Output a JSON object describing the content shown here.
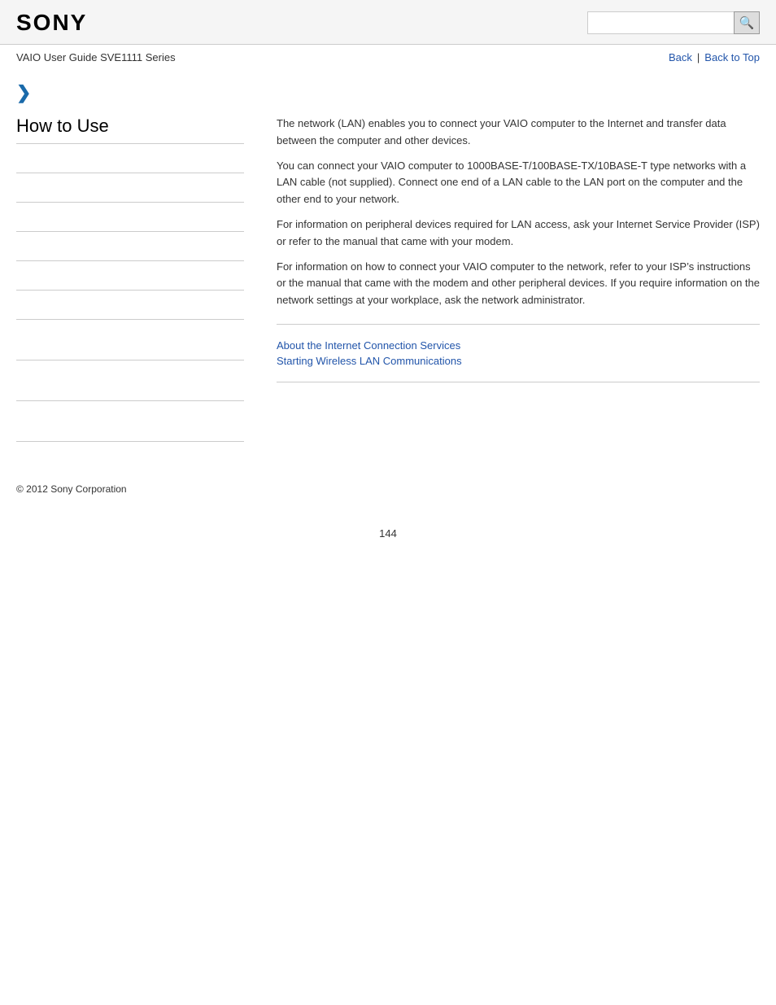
{
  "header": {
    "logo": "SONY",
    "search_placeholder": ""
  },
  "nav": {
    "guide_title": "VAIO User Guide SVE1111 Series",
    "back_label": "Back",
    "back_to_top_label": "Back to Top"
  },
  "chevron": "❯",
  "sidebar": {
    "title": "How to Use",
    "items": [
      {
        "id": "item1",
        "label": ""
      },
      {
        "id": "item2",
        "label": ""
      },
      {
        "id": "item3",
        "label": ""
      },
      {
        "id": "item4",
        "label": ""
      },
      {
        "id": "item5",
        "label": ""
      },
      {
        "id": "item6",
        "label": ""
      },
      {
        "id": "item7",
        "label": ""
      },
      {
        "id": "item8",
        "label": ""
      },
      {
        "id": "item9",
        "label": ""
      }
    ]
  },
  "content": {
    "paragraph1": "The network (LAN) enables you to connect your VAIO computer to the Internet and transfer data between the computer and other devices.",
    "paragraph2": "You can connect your VAIO computer to 1000BASE-T/100BASE-TX/10BASE-T type networks with a LAN cable (not supplied). Connect one end of a LAN cable to the LAN port on the computer and the other end to your network.",
    "paragraph3": "For information on peripheral devices required for LAN access, ask your Internet Service Provider (ISP) or refer to the manual that came with your modem.",
    "paragraph4": "For information on how to connect your VAIO computer to the network, refer to your ISP’s instructions or the manual that came with the modem and other peripheral devices. If you require information on the network settings at your workplace, ask the network administrator.",
    "links": [
      {
        "label": "About the Internet Connection Services",
        "id": "link-internet-connection"
      },
      {
        "label": "Starting Wireless LAN Communications",
        "id": "link-wireless-lan"
      }
    ]
  },
  "footer": {
    "copyright": "© 2012 Sony Corporation"
  },
  "page_number": "144",
  "icons": {
    "search": "🔍"
  }
}
